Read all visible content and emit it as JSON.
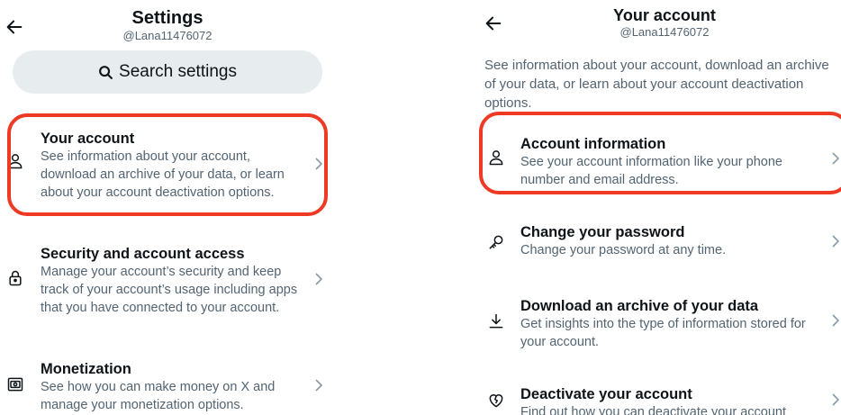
{
  "left_screen": {
    "header": {
      "title": "Settings",
      "handle": "@Lana11476072"
    },
    "search": {
      "label": "Search settings"
    },
    "items": [
      {
        "title": "Your account",
        "description": "See information about your account, download an archive of your data, or learn about your account deactivation options."
      },
      {
        "title": "Security and account access",
        "description": "Manage your account’s security and keep track of your account’s usage including apps that you have connected to your account."
      },
      {
        "title": "Monetization",
        "description": "See how you can make money on X and manage your monetization options."
      }
    ]
  },
  "right_screen": {
    "header": {
      "title": "Your account",
      "handle": "@Lana11476072"
    },
    "intro": "See information about your account, download an archive of your data, or learn about your account deactivation options.",
    "items": [
      {
        "title": "Account information",
        "description": "See your account information like your phone number and email address."
      },
      {
        "title": "Change your password",
        "description": "Change your password at any time."
      },
      {
        "title": "Download an archive of your data",
        "description": "Get insights into the type of information stored for your account."
      },
      {
        "title": "Deactivate your account",
        "description": "Find out how you can deactivate your account"
      }
    ]
  },
  "colors": {
    "highlight": "#ee3a24",
    "muted_text": "#536471",
    "search_bg": "#e7ecee"
  },
  "icons": [
    "back-arrow-icon",
    "search-icon",
    "person-icon",
    "lock-icon",
    "monetization-icon",
    "key-icon",
    "download-icon",
    "broken-heart-icon",
    "chevron-right-icon"
  ]
}
